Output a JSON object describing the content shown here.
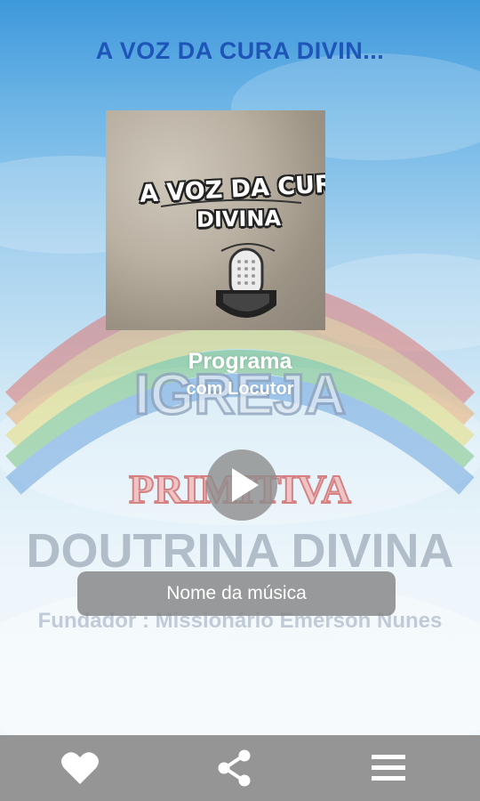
{
  "header": {
    "title": "A VOZ DA CURA DIVIN..."
  },
  "cover": {
    "line1": "A VOZ DA CUR",
    "line2": "DIVINA"
  },
  "program": {
    "title": "Programa",
    "subtitle": "com Locutor"
  },
  "player": {
    "song_label": "Nome da música"
  },
  "background_logo": {
    "word1": "IGREJA",
    "word2": "PRIMITIVA",
    "word3": "DOUTRINA DIVINA",
    "founder": "Fundador : Missionário Emerson Nunes"
  },
  "bottom_nav": {
    "icons": [
      "heart-icon",
      "share-icon",
      "menu-icon"
    ]
  },
  "colors": {
    "title_blue": "#1f55b8",
    "bar_gray": "#969595",
    "overlay_gray": "#848484"
  }
}
